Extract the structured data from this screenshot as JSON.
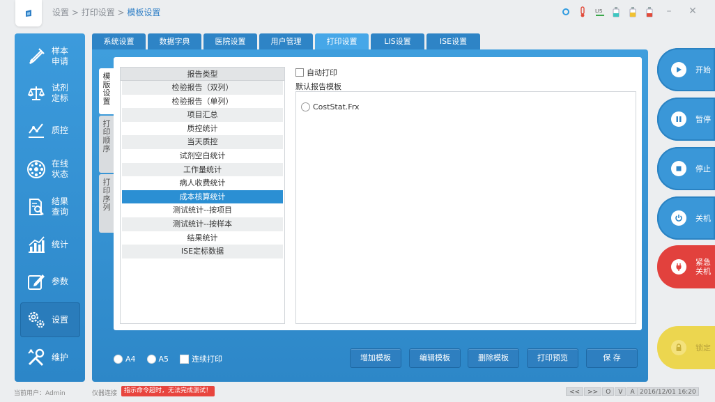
{
  "breadcrumb": {
    "part1": "设置",
    "sep1": " > ",
    "part2": "打印设置",
    "sep2": " > ",
    "current": "模板设置"
  },
  "status_icons": [
    "power-dot-icon",
    "thermometer-icon",
    "lis-link-icon",
    "reagent-bottle-teal-icon",
    "reagent-bottle-yellow-icon",
    "reagent-bottle-red-icon"
  ],
  "window": {
    "minimize": "–",
    "close": "✕"
  },
  "sidebar": {
    "items": [
      {
        "label": "样本申请",
        "icon": "sample-tube-icon"
      },
      {
        "label": "试剂定标",
        "icon": "balance-scale-icon"
      },
      {
        "label": "质控",
        "icon": "qc-line-icon"
      },
      {
        "label": "在线状态",
        "icon": "rotor-icon"
      },
      {
        "label": "结果查询",
        "icon": "result-search-icon"
      },
      {
        "label": "统计",
        "icon": "bar-chart-icon"
      },
      {
        "label": "参数",
        "icon": "edit-param-icon"
      },
      {
        "label": "设置",
        "icon": "gear-icon"
      },
      {
        "label": "维护",
        "icon": "wrench-icon"
      }
    ],
    "active": "设置"
  },
  "tabs": [
    "系统设置",
    "数据字典",
    "医院设置",
    "用户管理",
    "打印设置",
    "LIS设置",
    "ISE设置"
  ],
  "active_tab": "打印设置",
  "vtabs": [
    "模版设置",
    "打印顺序",
    "打印序列"
  ],
  "active_vtab": "模版设置",
  "report_types": {
    "header": "报告类型",
    "rows": [
      "检验报告（双列）",
      "检验报告（单列）",
      "项目汇总",
      "质控统计",
      "当天质控",
      "试剂空白统计",
      "工作量统计",
      "病人收费统计",
      "成本核算统计",
      "测试统计--按项目",
      "测试统计--按样本",
      "结果统计",
      "ISE定标数据"
    ],
    "selected": "成本核算统计"
  },
  "auto_print": {
    "label": "自动打印",
    "checked": false
  },
  "default_template": {
    "label": "默认报告模板",
    "items": [
      "CostStat.Frx"
    ]
  },
  "paper": {
    "a4": "A4",
    "a5": "A5",
    "continuous": "连续打印"
  },
  "actions": {
    "add": "增加模板",
    "edit": "编辑模板",
    "delete": "删除模板",
    "preview": "打印预览",
    "save": "保 存"
  },
  "controls": {
    "start": "开始",
    "pause": "暂停",
    "stop": "停止",
    "shutdown": "关机",
    "emergency": "紧急关机",
    "lock": "锁定"
  },
  "colors": {
    "sidebar": "#3a97d8",
    "selected_row": "#2b8fd3",
    "emergency": "#e2413d",
    "lock": "#ecd64f"
  },
  "status": {
    "user_label": "当前用户：Admin",
    "conn_label": "仪器连接",
    "error": "指示命令超时，无法完成测试！",
    "pager": [
      "<<",
      ">>",
      "O",
      "V",
      "A"
    ],
    "datetime": "2016/12/01 16:20"
  }
}
